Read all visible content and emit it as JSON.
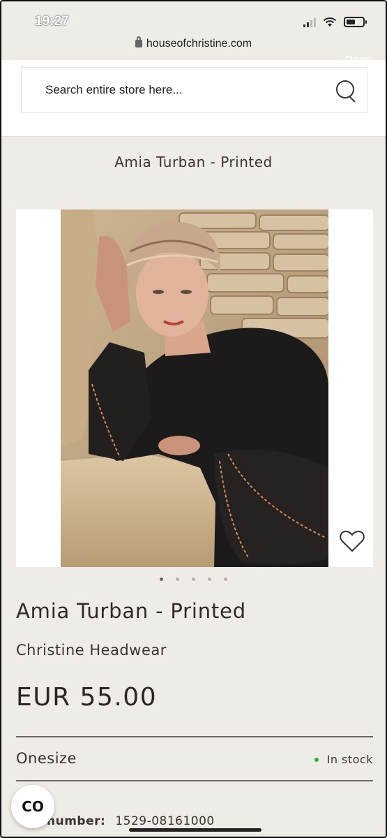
{
  "status_bar": {
    "time": "19:27",
    "url": "houseofchristine.com",
    "done_label": "Done"
  },
  "search": {
    "placeholder": "Search entire store here..."
  },
  "breadcrumb_title": "Amia Turban - Printed",
  "gallery": {
    "image_alt": "Woman wearing a printed turban and black top leaning against a stone wall",
    "dot_count": 5,
    "active_dot": 0
  },
  "product": {
    "title": "Amia Turban - Printed",
    "brand": "Christine Headwear",
    "price": "EUR 55.00",
    "size": "Onesize",
    "stock_status": "In stock",
    "article_label": "number:",
    "article_number": "1529-08161000"
  },
  "fab_label": "CO",
  "colors": {
    "background": "#efebe7",
    "in_stock": "#2eaa4a",
    "text": "#2b2622"
  }
}
